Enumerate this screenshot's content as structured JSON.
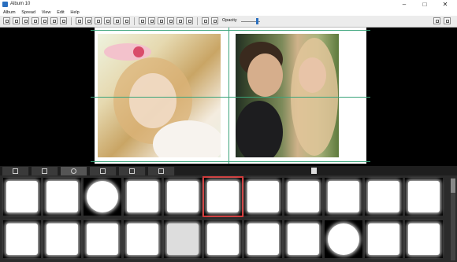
{
  "window": {
    "title": "Album 10"
  },
  "menu": [
    "Album",
    "Spread",
    "View",
    "Edit",
    "Help"
  ],
  "toolbar": {
    "opacity_label": "Opacity",
    "opacity_value": 0.85
  },
  "tabs": [
    {
      "icon": "image-icon",
      "active": false
    },
    {
      "icon": "page-icon",
      "active": false
    },
    {
      "icon": "mask-icon",
      "active": true
    },
    {
      "icon": "texture-icon",
      "active": false
    },
    {
      "icon": "no-mask-icon",
      "active": false
    },
    {
      "icon": "layout-icon",
      "active": false
    }
  ],
  "masks": {
    "rows": 2,
    "cols": 11,
    "selected_index": 5
  }
}
